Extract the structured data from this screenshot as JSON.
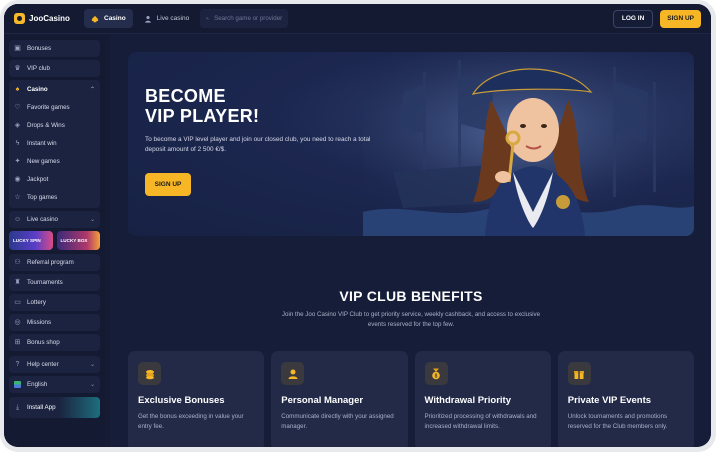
{
  "header": {
    "brand": "JooCasino",
    "nav": [
      {
        "label": "Casino",
        "icon": "spade-icon",
        "active": true
      },
      {
        "label": "Live casino",
        "icon": "dealer-icon",
        "active": false
      }
    ],
    "search_placeholder": "Search game or provider",
    "login_label": "LOG IN",
    "signup_label": "SIGN UP"
  },
  "sidebar": {
    "top_items": [
      {
        "label": "Bonuses",
        "icon": "gift-icon"
      },
      {
        "label": "VIP club",
        "icon": "crown-icon"
      }
    ],
    "casino_group": {
      "label": "Casino",
      "items": [
        {
          "label": "Favorite games",
          "icon": "heart-icon"
        },
        {
          "label": "Drops & Wins",
          "icon": "drops-icon"
        },
        {
          "label": "Instant win",
          "icon": "bolt-icon"
        },
        {
          "label": "New games",
          "icon": "new-icon"
        },
        {
          "label": "Jackpot",
          "icon": "jackpot-icon"
        },
        {
          "label": "Top games",
          "icon": "star-icon"
        }
      ]
    },
    "live_casino": {
      "label": "Live casino",
      "icon": "dealer-icon"
    },
    "promos": [
      {
        "label": "LUCKY SPIN"
      },
      {
        "label": "LUCKY BOX"
      }
    ],
    "bottom_items": [
      {
        "label": "Referral program",
        "icon": "referral-icon"
      },
      {
        "label": "Tournaments",
        "icon": "trophy-icon"
      },
      {
        "label": "Lottery",
        "icon": "ticket-icon"
      },
      {
        "label": "Missions",
        "icon": "target-icon"
      },
      {
        "label": "Bonus shop",
        "icon": "shop-icon"
      }
    ],
    "help": {
      "label": "Help center",
      "icon": "help-icon"
    },
    "language": {
      "label": "English",
      "icon": "flag-icon"
    },
    "install": {
      "label": "Install App",
      "icon": "download-icon"
    }
  },
  "hero": {
    "title_line1": "BECOME",
    "title_line2": "VIP PLAYER!",
    "text": "To become a VIP level player and join our closed club, you need to reach a total deposit amount of 2 500 €/$.",
    "button": "SIGN UP"
  },
  "benefits": {
    "title": "VIP CLUB BENEFITS",
    "subtitle": "Join the Joo Casino VIP Club to get priority service, weekly cashback, and access to exclusive events reserved for the top few.",
    "cards": [
      {
        "title": "Exclusive Bonuses",
        "desc": "Get the bonus exceeding in value your entry fee.",
        "icon": "coins-icon"
      },
      {
        "title": "Personal Manager",
        "desc": "Communicate directly with your assigned manager.",
        "icon": "manager-icon"
      },
      {
        "title": "Withdrawal Priority",
        "desc": "Prioritized processing of withdrawals and increased withdrawal limits.",
        "icon": "medal-icon"
      },
      {
        "title": "Private VIP Events",
        "desc": "Unlock tournaments and promotions reserved for the Club members only.",
        "icon": "gift-icon"
      }
    ]
  },
  "colors": {
    "accent": "#f6b626",
    "background": "#141b33",
    "card": "#222a48"
  }
}
